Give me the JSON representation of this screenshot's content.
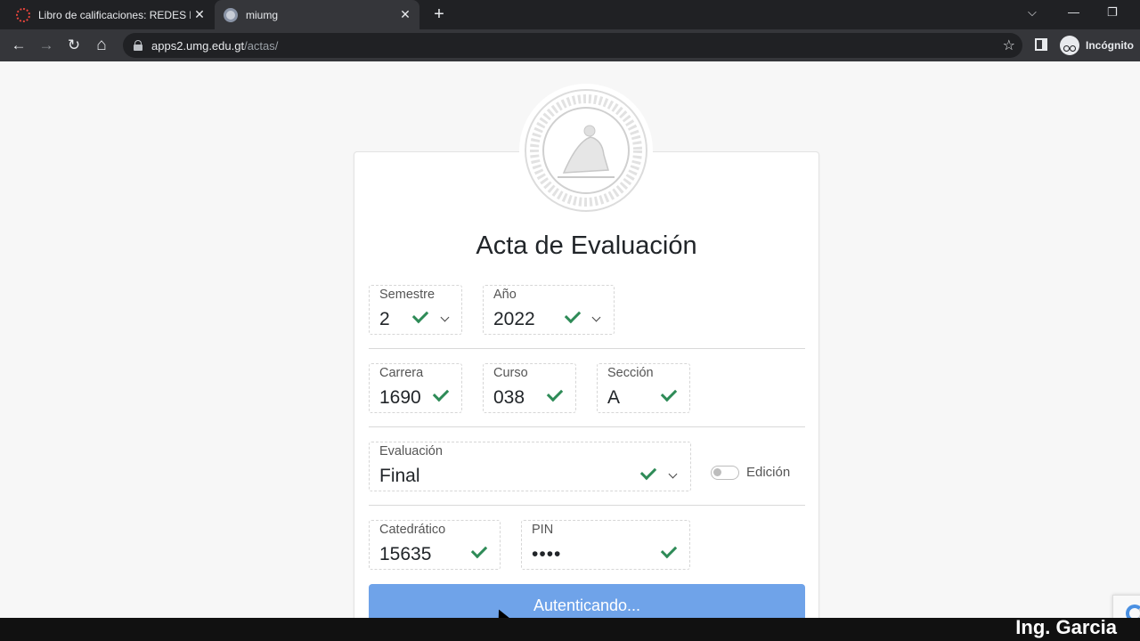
{
  "browser": {
    "tabs": [
      {
        "title": "Libro de calificaciones: REDES DE",
        "close": "✕"
      },
      {
        "title": "miumg",
        "close": "✕"
      }
    ],
    "new_tab": "+",
    "window_controls": {
      "tab_search": "⌵",
      "minimize": "—",
      "restore": "❐"
    },
    "nav": {
      "back": "←",
      "forward": "→",
      "reload": "↻",
      "home": "⌂"
    },
    "url": {
      "host": "apps2.umg.edu.gt",
      "path": "/actas/"
    },
    "bookmark": "☆",
    "profile_label": "Incógnito"
  },
  "page": {
    "title": "Acta de Evaluación",
    "fields": {
      "semestre": {
        "label": "Semestre",
        "value": "2"
      },
      "anio": {
        "label": "Año",
        "value": "2022"
      },
      "carrera": {
        "label": "Carrera",
        "value": "1690"
      },
      "curso": {
        "label": "Curso",
        "value": "038"
      },
      "seccion": {
        "label": "Sección",
        "value": "A"
      },
      "evaluacion": {
        "label": "Evaluación",
        "value": "Final"
      },
      "catedratico": {
        "label": "Catedrático",
        "value": "15635"
      },
      "pin": {
        "label": "PIN",
        "value": "••••"
      }
    },
    "edit_toggle": {
      "label": "Edición",
      "on": false
    },
    "submit_button": "Autenticando..."
  },
  "watermark": "Ing. Garcia",
  "colors": {
    "check": "#2e8b57",
    "button": "#6fa3e9",
    "chrome_dark": "#202124"
  }
}
